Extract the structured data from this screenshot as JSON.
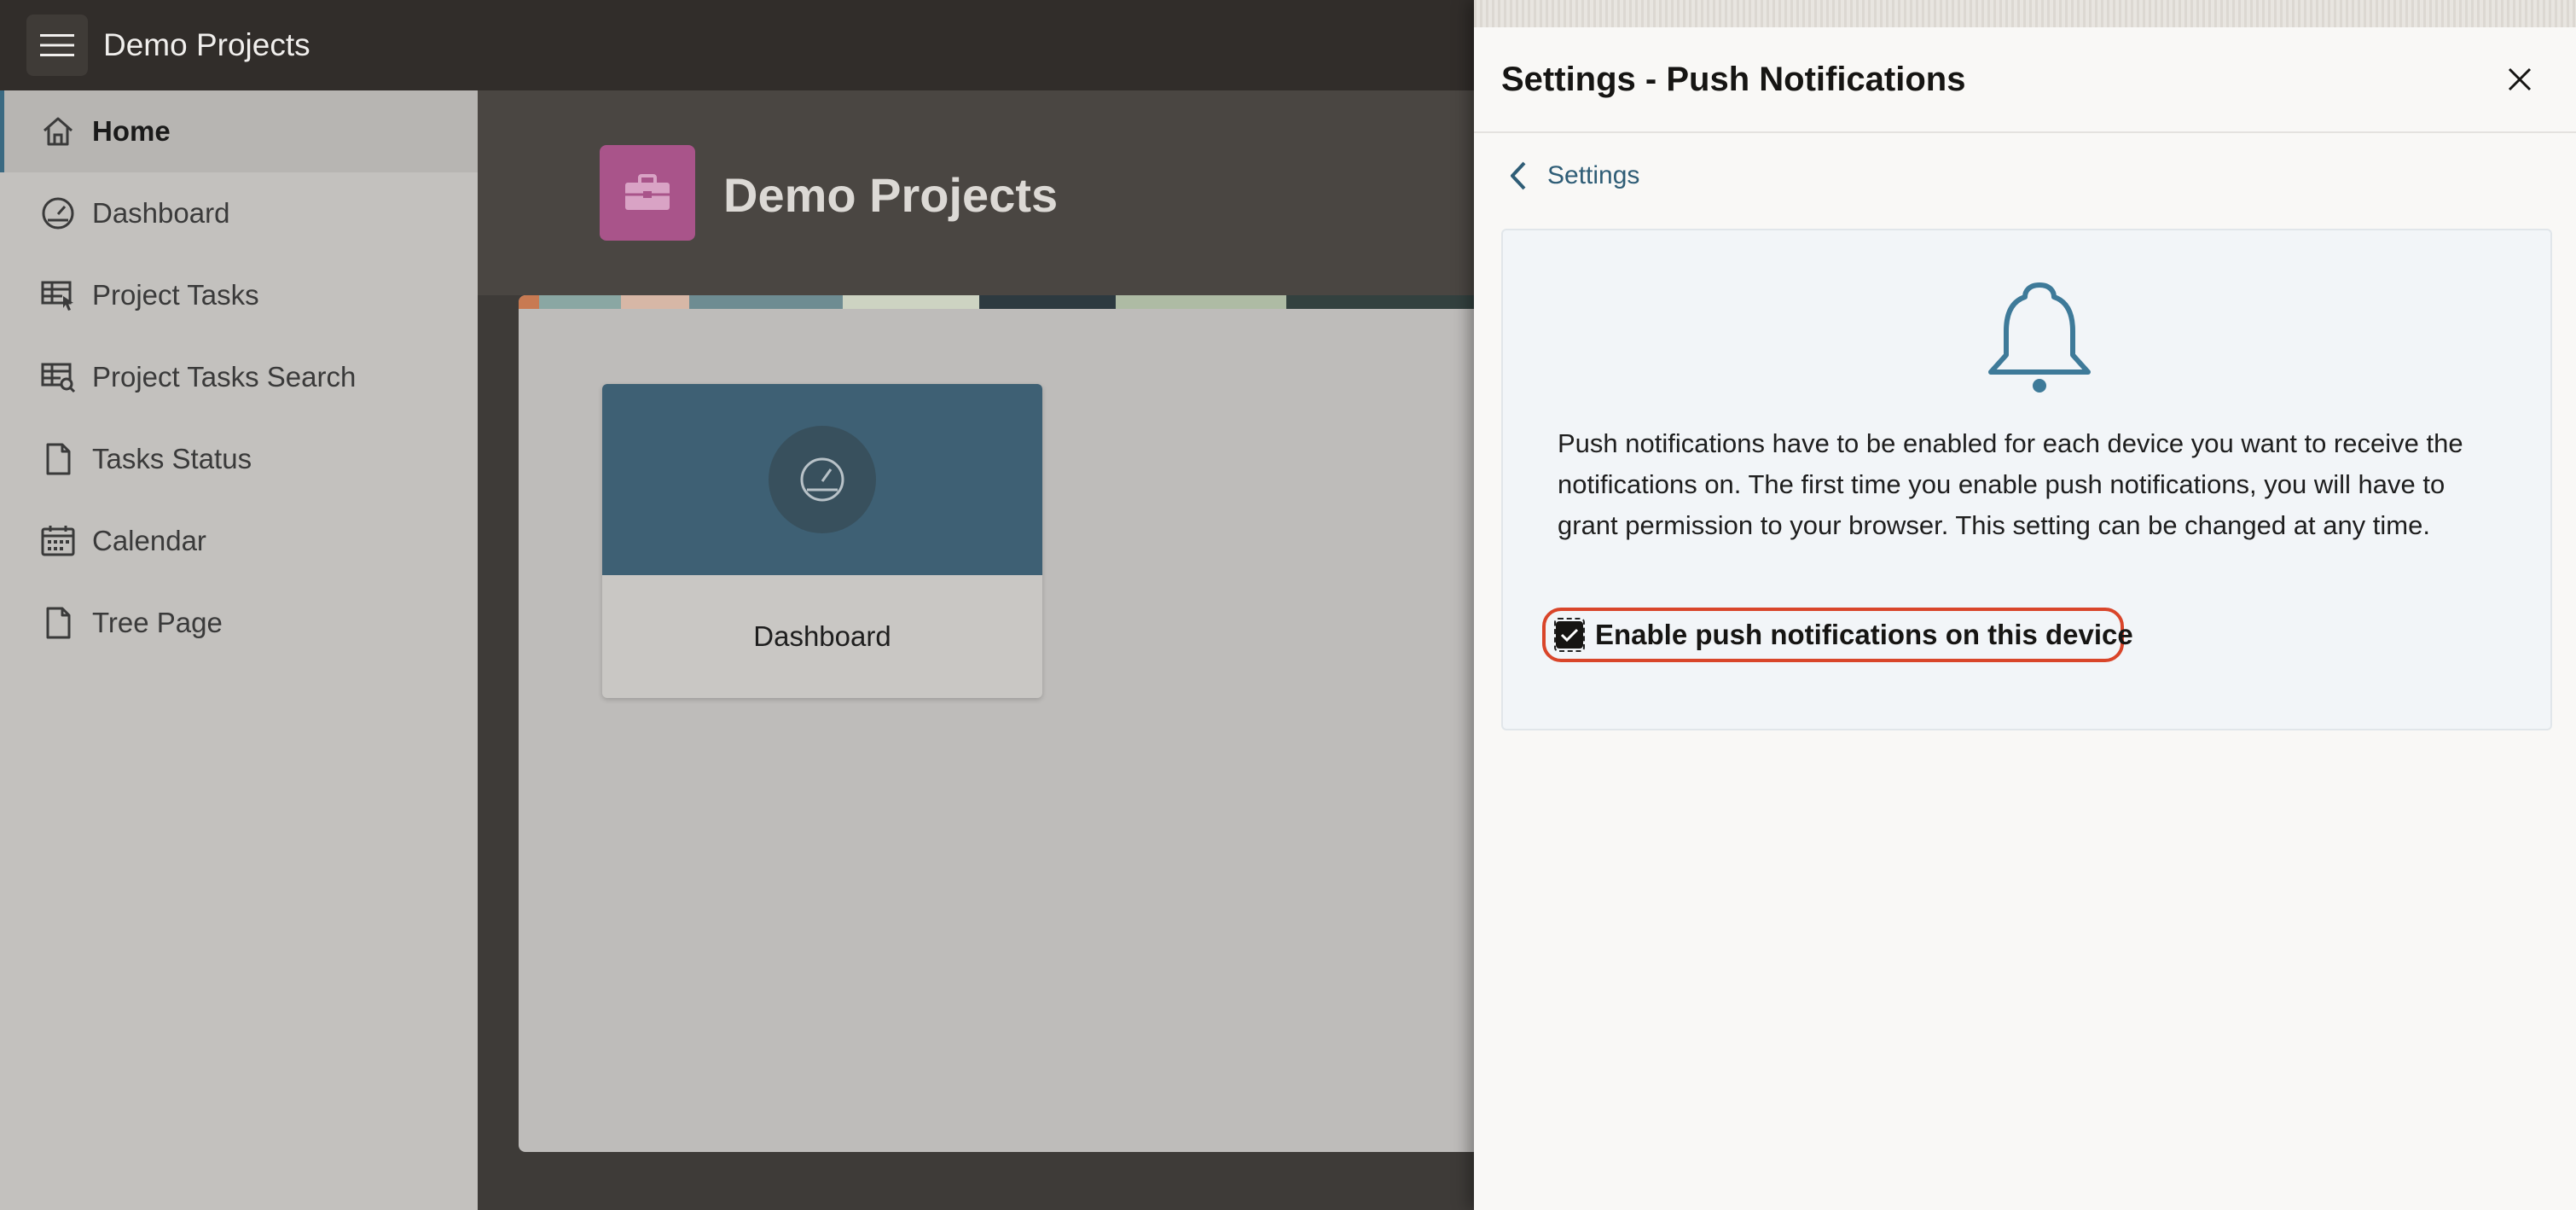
{
  "header": {
    "app_title": "Demo Projects",
    "menu_icon": "hamburger-icon"
  },
  "sidebar": {
    "items": [
      {
        "label": "Home",
        "icon": "home-icon",
        "active": true
      },
      {
        "label": "Dashboard",
        "icon": "gauge-icon"
      },
      {
        "label": "Project Tasks",
        "icon": "table-cursor-icon"
      },
      {
        "label": "Project Tasks Search",
        "icon": "table-search-icon"
      },
      {
        "label": "Tasks Status",
        "icon": "file-icon"
      },
      {
        "label": "Calendar",
        "icon": "calendar-icon"
      },
      {
        "label": "Tree Page",
        "icon": "file-icon"
      }
    ]
  },
  "main": {
    "hero_title": "Demo Projects",
    "hero_icon": "briefcase-icon",
    "cards": [
      {
        "label": "Dashboard",
        "icon": "gauge-icon"
      }
    ]
  },
  "drawer": {
    "title": "Settings - Push Notifications",
    "back_label": "Settings",
    "description": "Push notifications have to be enabled for each device you want to receive the notifications on. The first time you enable push notifications, you will have to grant permission to your browser. This setting can be changed at any time.",
    "checkbox_label": "Enable push notifications on this device",
    "checkbox_checked": true,
    "icon": "bell-icon"
  },
  "colors": {
    "accent": "#2f5d76",
    "highlight_border": "#d9452a",
    "app_badge": "#a9548a",
    "card_header": "#3e6074"
  }
}
